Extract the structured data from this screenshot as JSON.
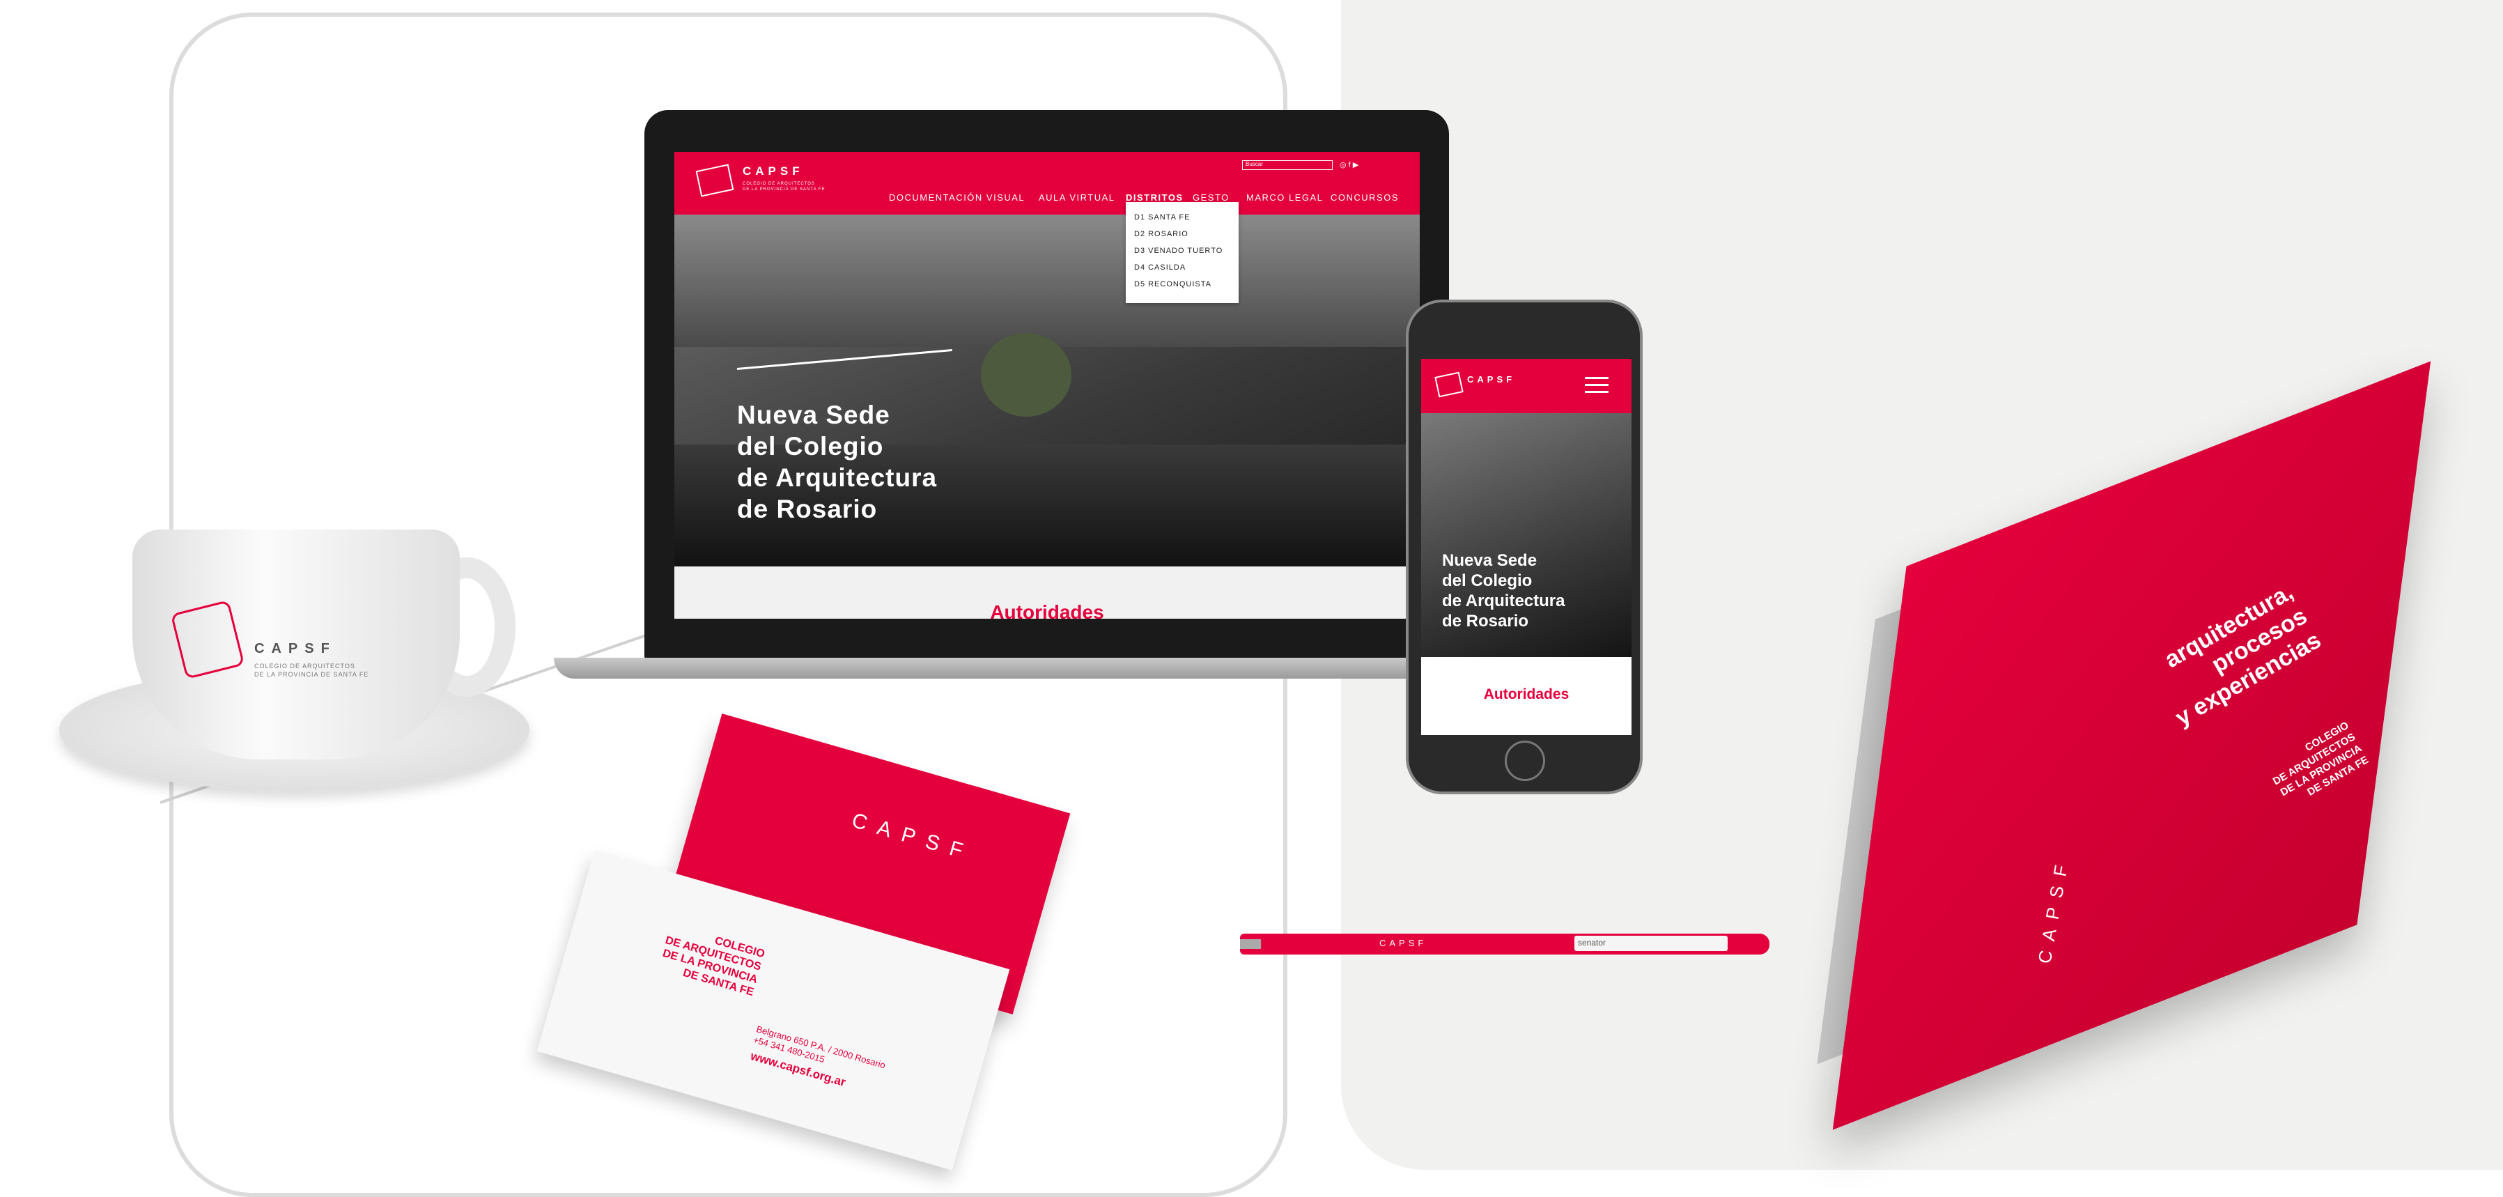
{
  "site": {
    "brand": "CAPSF",
    "brand_sub": "COLEGIO DE ARQUITECTOS\nDE LA PROVINCIA DE SANTA FE",
    "nav": [
      "DOCUMENTACIÓN VISUAL",
      "AULA VIRTUAL",
      "DISTRITOS",
      "GESTO",
      "MARCO LEGAL",
      "CONCURSOS"
    ],
    "search_placeholder": "Buscar",
    "districts": [
      "D1 SANTA FE",
      "D2 ROSARIO",
      "D3 VENADO TUERTO",
      "D4 CASILDA",
      "D5 RECONQUISTA"
    ],
    "hero_title": "Nueva Sede\ndel Colegio\nde Arquitectura\nde Rosario",
    "section_title": "Autoridades"
  },
  "cup": {
    "brand": "CAPSF",
    "sub": "COLEGIO DE ARQUITECTOS\nDE LA PROVINCIA DE SANTA FE"
  },
  "card": {
    "box_brand": "CAPSF",
    "title": "COLEGIO\nDE ARQUITECTOS\nDE LA PROVINCIA\nDE SANTA FE",
    "address": "Belgrano 650 P.A. / 2000 Rosario\n+54 341 480-2015",
    "web": "www.capsf.org.ar"
  },
  "pen": {
    "brand": "CAPSF",
    "maker": "senator"
  },
  "book": {
    "title": "arquitectura,\nprocesos\ny experiencias",
    "sub": "COLEGIO\nDE ARQUITECTOS\nDE LA PROVINCIA\nDE SANTA FE",
    "spine": "CAPSF"
  },
  "colors": {
    "brand_red": "#e4003c",
    "background": "#ffffff",
    "panel": "#f1f1ef"
  }
}
